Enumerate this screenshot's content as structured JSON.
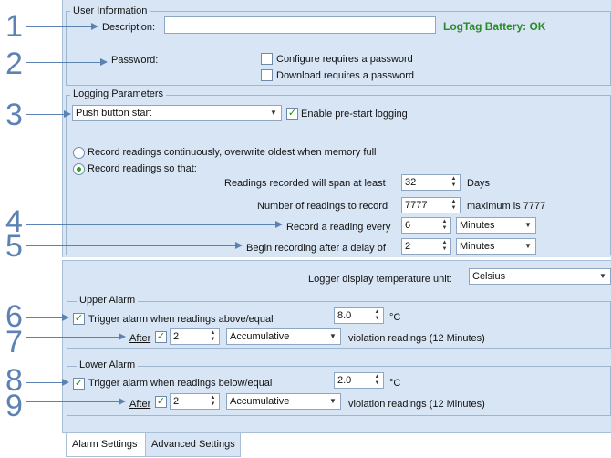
{
  "callouts": [
    "1",
    "2",
    "3",
    "4",
    "5",
    "6",
    "7",
    "8",
    "9"
  ],
  "user_info": {
    "title": "User Information",
    "description_label": "Description:",
    "description_value": "",
    "battery_status": "LogTag Battery: OK",
    "password_label": "Password:",
    "configure_pw": "Configure requires a password",
    "download_pw": "Download requires a password"
  },
  "logging": {
    "title": "Logging Parameters",
    "start_mode": "Push button start",
    "enable_prestart": "Enable pre-start logging",
    "record_continuous": "Record readings continuously, overwrite oldest when memory full",
    "record_so_that": "Record readings so that:",
    "span_label": "Readings recorded will span at least",
    "span_value": "32",
    "span_unit": "Days",
    "num_label": "Number of readings to record",
    "num_value": "7777",
    "num_max": "maximum is 7777",
    "every_label": "Record a reading every",
    "every_value": "6",
    "every_unit": "Minutes",
    "delay_label": "Begin recording after a delay of",
    "delay_value": "2",
    "delay_unit": "Minutes"
  },
  "alarm": {
    "display_unit_label": "Logger display temperature unit:",
    "display_unit_value": "Celsius",
    "upper": {
      "title": "Upper Alarm",
      "trigger_label": "Trigger alarm when readings above/equal",
      "value": "8.0",
      "unit": "°C",
      "after_label": "After",
      "after_count": "2",
      "mode": "Accumulative",
      "violation_text": "violation readings (12 Minutes)"
    },
    "lower": {
      "title": "Lower Alarm",
      "trigger_label": "Trigger alarm when readings below/equal",
      "value": "2.0",
      "unit": "°C",
      "after_label": "After",
      "after_count": "2",
      "mode": "Accumulative",
      "violation_text": "violation readings (12 Minutes)"
    }
  },
  "tabs": [
    "Alarm Settings",
    "Advanced Settings"
  ],
  "colors": {
    "panel": "#d8e5f4",
    "callout": "#5c82b4",
    "battery_ok": "#2a8a2a"
  },
  "icons": {
    "checkbox_checked": "checkmark-icon",
    "dropdown": "chevron-down-icon",
    "spinner": "up-down-arrows-icon"
  }
}
